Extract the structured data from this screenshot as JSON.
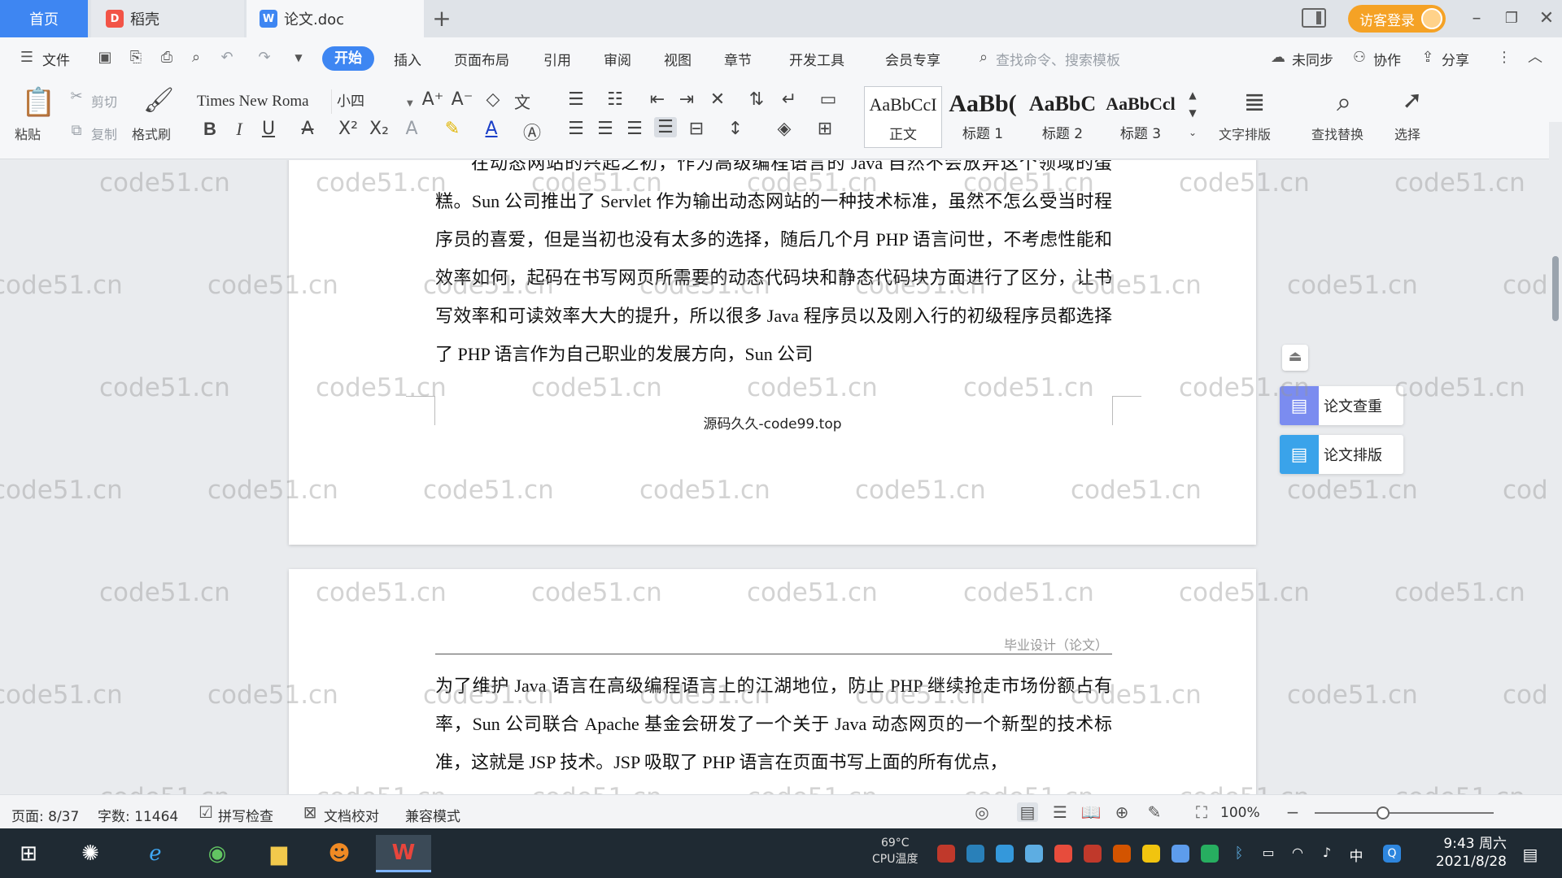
{
  "titlebar": {
    "tabs": [
      {
        "label": "首页"
      },
      {
        "label": "稻壳",
        "icon": "docer-icon"
      },
      {
        "label": "论文.doc",
        "icon": "word-doc-icon"
      }
    ],
    "add_tab": "+",
    "login_label": "访客登录"
  },
  "menu": {
    "file": "文件",
    "items": [
      "开始",
      "插入",
      "页面布局",
      "引用",
      "审阅",
      "视图",
      "章节",
      "开发工具",
      "会员专享"
    ],
    "search_placeholder": "查找命令、搜索模板",
    "sync": "未同步",
    "collab": "协作",
    "share": "分享"
  },
  "ribbon": {
    "paste": "粘贴",
    "cut": "剪切",
    "copy": "复制",
    "format_painter": "格式刷",
    "font_name": "Times New Roma",
    "font_size": "小四",
    "styles": [
      {
        "preview": "AaBbCcI",
        "label": "正文"
      },
      {
        "preview": "AaBb(",
        "label": "标题 1"
      },
      {
        "preview": "AaBbC",
        "label": "标题 2"
      },
      {
        "preview": "AaBbCcl",
        "label": "标题 3"
      }
    ],
    "text_layout": "文字排版",
    "find_replace": "查找替换",
    "select": "选择"
  },
  "document": {
    "page1_lines": [
      "在动态网站的兴起之初，作为高级编程语言的 Java 自然不会放弃这个领域",
      "的蛋糕。Sun 公司推出了 Servlet 作为输出动态网站的一种技术标准，虽然不怎",
      "么受当时程序员的喜爱，但是当初也没有太多的选择，随后几个月 PHP 语言问",
      "世，不考虑性能和效率如何，起码在书写网页所需要的动态代码块和静态代码块",
      "方面进行了区分，让书写效率和可读效率大大的提升，所以很多 Java 程序员以",
      "及刚入行的初级程序员都选择了 PHP 语言作为自己职业的发展方向，Sun 公司"
    ],
    "footer": "源码久久-code99.top",
    "page2_header": "毕业设计（论文）",
    "page2_lines": [
      "为了维护 Java 语言在高级编程语言上的江湖地位，防止 PHP 继续抢走市场份额",
      "占有率，Sun 公司联合 Apache 基金会研发了一个关于 Java 动态网页的一个新型",
      "的技术标准，这就是 JSP 技术。JSP 吸取了 PHP 语言在页面书写上面的所有优点，"
    ],
    "watermark": "code51.cn"
  },
  "side_panel": {
    "check": "论文查重",
    "format": "论文排版"
  },
  "status": {
    "page": "页面: 8/37",
    "words": "字数: 11464",
    "spell": "拼写检查",
    "proof": "文档校对",
    "compat": "兼容模式",
    "zoom": "100%",
    "zoom_fraction": 0.38
  },
  "taskbar": {
    "cpu_temp": "69°C",
    "cpu_label": "CPU温度",
    "ime": "中",
    "time": "9:43 周六",
    "date": "2021/8/28"
  }
}
